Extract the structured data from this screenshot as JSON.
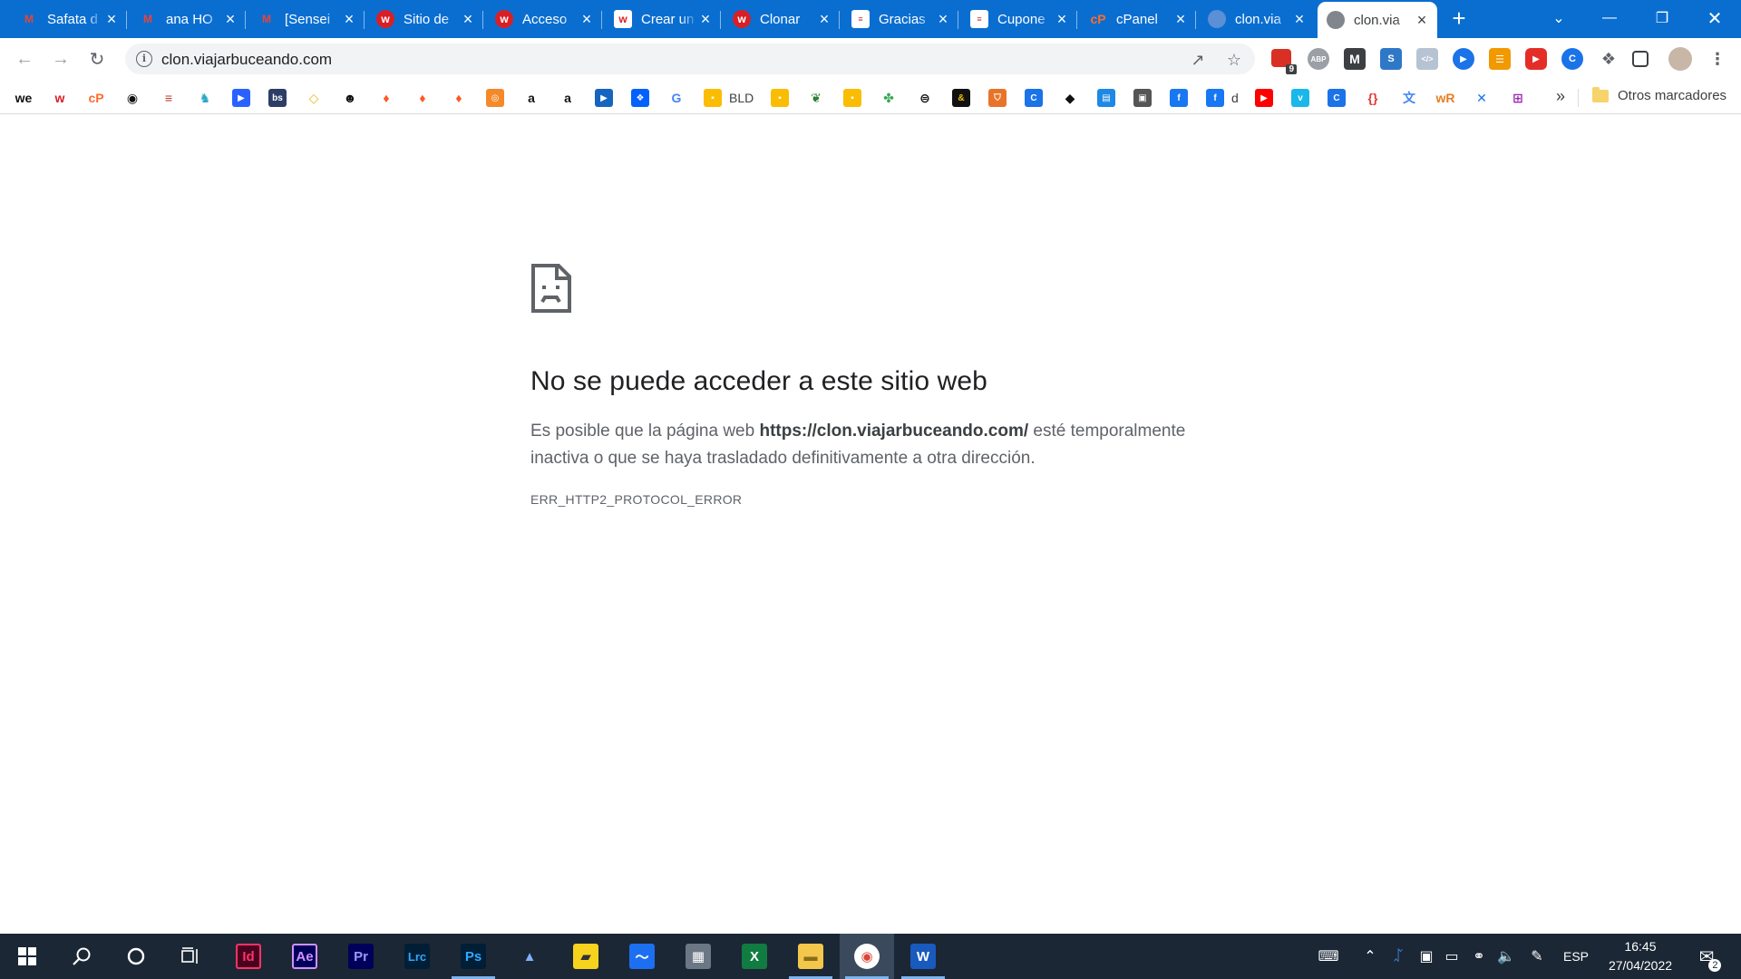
{
  "browser": {
    "tabs": [
      {
        "title": "Safata d",
        "icon": "gmail-icon"
      },
      {
        "title": "ana HO",
        "icon": "gmail-icon"
      },
      {
        "title": "[Sensei",
        "icon": "gmail-icon"
      },
      {
        "title": "Sitio de",
        "icon": "wix-w-icon"
      },
      {
        "title": "Acceso",
        "icon": "wix-w-icon"
      },
      {
        "title": "Crear un",
        "icon": "wix-w-icon"
      },
      {
        "title": "Clonar",
        "icon": "wix-w-icon"
      },
      {
        "title": "Gracias",
        "icon": "viajar-icon"
      },
      {
        "title": "Cupone",
        "icon": "viajar-icon"
      },
      {
        "title": "cPanel",
        "icon": "cpanel-icon"
      },
      {
        "title": "clon.via",
        "icon": "globe-icon"
      },
      {
        "title": "clon.via",
        "icon": "globe-icon",
        "active": true
      }
    ],
    "new_tab": "+",
    "address": "clon.viajarbuceando.com",
    "extension_badge": "9",
    "colors": {
      "tabstrip": "#0a6ed1",
      "taskbar": "#1b2735"
    }
  },
  "bookmarks": {
    "items": [
      {
        "icon": "we-icon",
        "label": ""
      },
      {
        "icon": "wix-w-icon",
        "label": ""
      },
      {
        "icon": "cpanel-icon",
        "label": ""
      },
      {
        "icon": "target-icon",
        "label": ""
      },
      {
        "icon": "viajar-icon",
        "label": ""
      },
      {
        "icon": "bird-icon",
        "label": ""
      },
      {
        "icon": "play-square-icon",
        "label": ""
      },
      {
        "icon": "bs-icon",
        "label": ""
      },
      {
        "icon": "diamond-icon",
        "label": ""
      },
      {
        "icon": "owl-icon",
        "label": ""
      },
      {
        "icon": "flame-icon",
        "label": ""
      },
      {
        "icon": "flame-icon",
        "label": ""
      },
      {
        "icon": "flame-icon",
        "label": ""
      },
      {
        "icon": "ubuntu-icon",
        "label": ""
      },
      {
        "icon": "amazon-icon",
        "label": ""
      },
      {
        "icon": "amazon-icon",
        "label": ""
      },
      {
        "icon": "play-circle-icon",
        "label": ""
      },
      {
        "icon": "dropbox-icon",
        "label": ""
      },
      {
        "icon": "google-icon",
        "label": ""
      },
      {
        "icon": "keep-icon",
        "label": "BLD"
      },
      {
        "icon": "keep-icon",
        "label": ""
      },
      {
        "icon": "leaf-icon",
        "label": ""
      },
      {
        "icon": "keep-icon",
        "label": ""
      },
      {
        "icon": "pinwheel-icon",
        "label": ""
      },
      {
        "icon": "lines-circle-icon",
        "label": ""
      },
      {
        "icon": "ampersand-icon",
        "label": ""
      },
      {
        "icon": "shield-icon",
        "label": ""
      },
      {
        "icon": "c-circle-icon",
        "label": ""
      },
      {
        "icon": "bookmark-dark-icon",
        "label": ""
      },
      {
        "icon": "calendar-icon",
        "label": ""
      },
      {
        "icon": "box-icon",
        "label": ""
      },
      {
        "icon": "facebook-icon",
        "label": ""
      },
      {
        "icon": "facebook-icon",
        "label": "d"
      },
      {
        "icon": "youtube-icon",
        "label": ""
      },
      {
        "icon": "vimeo-icon",
        "label": ""
      },
      {
        "icon": "c-circle-icon",
        "label": ""
      },
      {
        "icon": "code-icon",
        "label": ""
      },
      {
        "icon": "translate-icon",
        "label": ""
      },
      {
        "icon": "wr-icon",
        "label": ""
      },
      {
        "icon": "x-logo-icon",
        "label": ""
      },
      {
        "icon": "grid-icon",
        "label": ""
      }
    ],
    "more": "»",
    "other": "Otros marcadores"
  },
  "error_page": {
    "title": "No se puede acceder a este sitio web",
    "desc_before": "Es posible que la página web ",
    "desc_url": "https://clon.viajarbuceando.com/",
    "desc_after": " esté temporalmente inactiva o que se haya trasladado definitivamente a otra dirección.",
    "code": "ERR_HTTP2_PROTOCOL_ERROR"
  },
  "taskbar": {
    "apps": [
      {
        "name": "indesign-icon",
        "label": "Id"
      },
      {
        "name": "after-effects-icon",
        "label": "Ae"
      },
      {
        "name": "premiere-icon",
        "label": "Pr"
      },
      {
        "name": "lightroom-icon",
        "label": "Lrc"
      },
      {
        "name": "photoshop-icon",
        "label": "Ps"
      },
      {
        "name": "affinity-icon",
        "label": ""
      },
      {
        "name": "sticky-notes-icon",
        "label": ""
      },
      {
        "name": "whiteboard-icon",
        "label": ""
      },
      {
        "name": "calculator-icon",
        "label": ""
      },
      {
        "name": "excel-icon",
        "label": "X"
      },
      {
        "name": "file-explorer-icon",
        "label": ""
      },
      {
        "name": "chrome-icon",
        "label": ""
      },
      {
        "name": "word-icon",
        "label": "W"
      }
    ],
    "language": "ESP",
    "time": "16:45",
    "date": "27/04/2022",
    "notifications": "2"
  }
}
